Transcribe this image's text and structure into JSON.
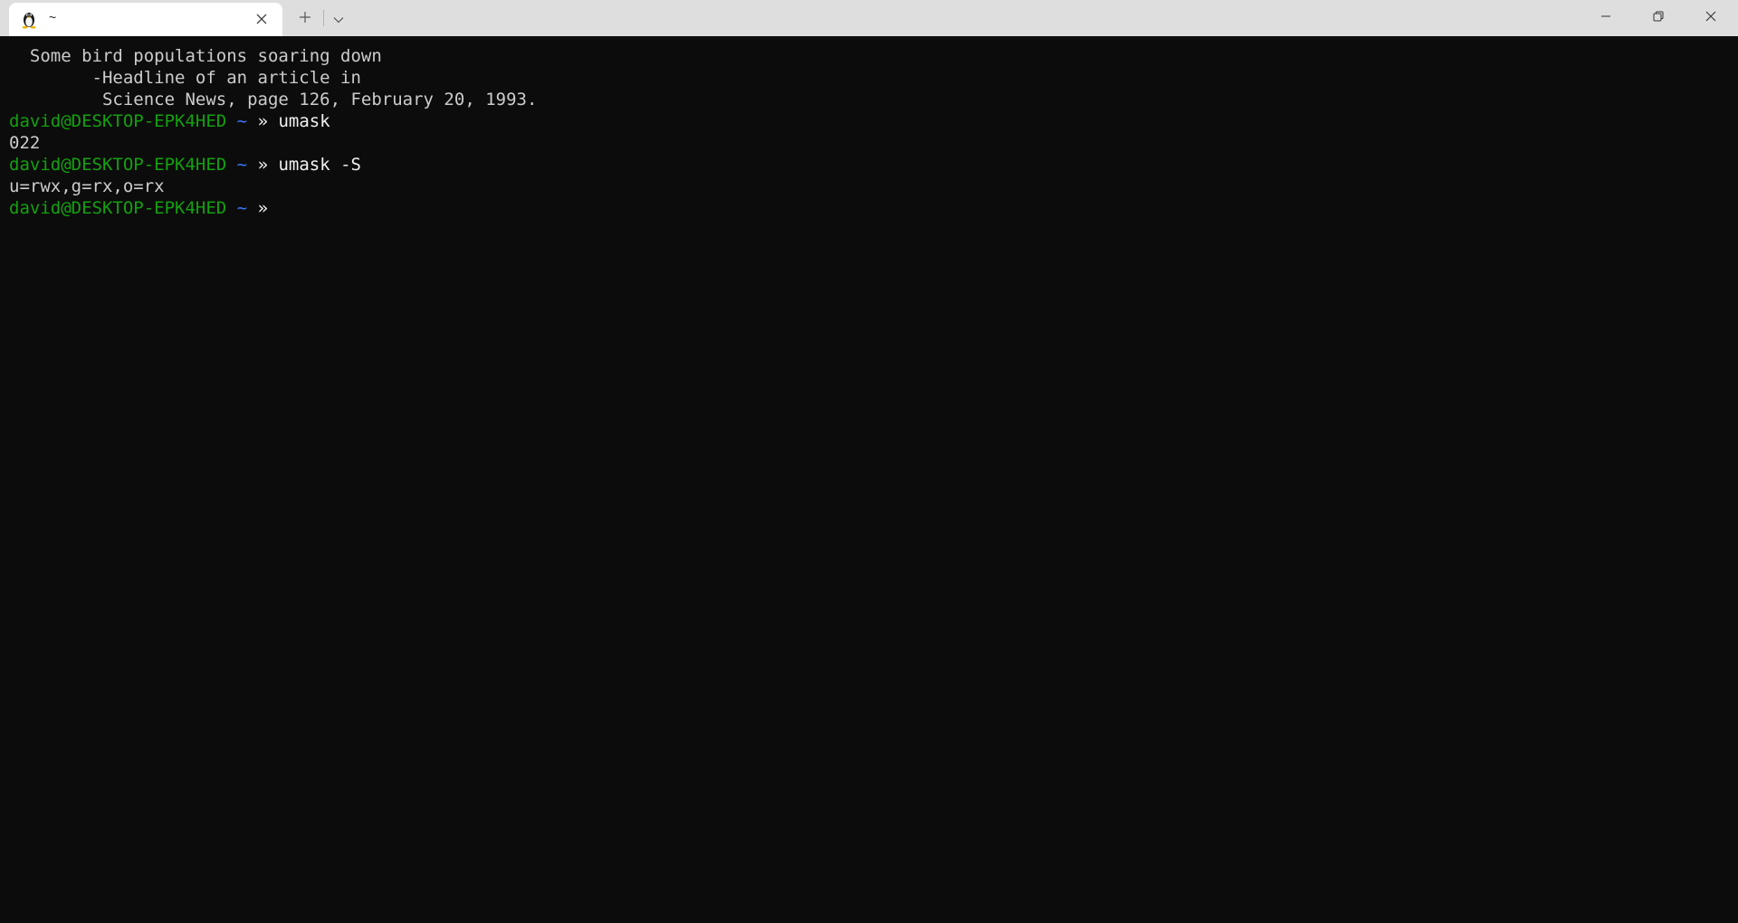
{
  "tab": {
    "icon": "linux-penguin-icon",
    "title": "~"
  },
  "fortune": [
    "  Some bird populations soaring down",
    "        -Headline of an article in",
    "         Science News, page 126, February 20, 1993."
  ],
  "prompt": {
    "user_host": "david@DESKTOP-EPK4HED",
    "cwd": "~",
    "symbol": "»"
  },
  "session": [
    {
      "command": "umask",
      "output": "022"
    },
    {
      "command": "umask -S",
      "output": "u=rwx,g=rx,o=rx"
    }
  ],
  "colors": {
    "background": "#0c0c0c",
    "prompt_user": "#13a10e",
    "prompt_cwd": "#3b78ff",
    "text": "#cccccc"
  }
}
